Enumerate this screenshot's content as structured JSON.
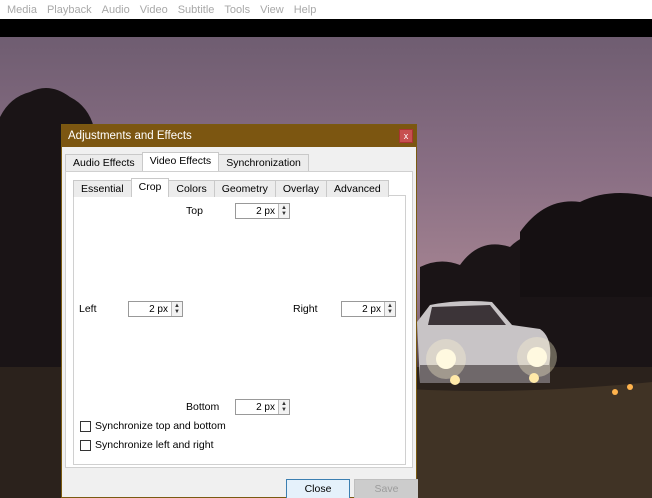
{
  "menu": [
    "Media",
    "Playback",
    "Audio",
    "Video",
    "Subtitle",
    "Tools",
    "View",
    "Help"
  ],
  "dialog": {
    "title": "Adjustments and Effects",
    "close_glyph": "x",
    "tabs": [
      "Audio Effects",
      "Video Effects",
      "Synchronization"
    ],
    "active_tab": "Video Effects",
    "subtabs": [
      "Essential",
      "Crop",
      "Colors",
      "Geometry",
      "Overlay",
      "Advanced"
    ],
    "active_subtab": "Crop",
    "crop": {
      "top_label": "Top",
      "top_value": "2 px",
      "left_label": "Left",
      "left_value": "2 px",
      "right_label": "Right",
      "right_value": "2 px",
      "bottom_label": "Bottom",
      "bottom_value": "2 px"
    },
    "sync_top_bottom": "Synchronize top and bottom",
    "sync_left_right": "Synchronize left and right",
    "close_button": "Close",
    "save_button": "Save"
  },
  "colors": {
    "titlebar": "#7c5611",
    "menu_text": "#a8a8a8"
  }
}
